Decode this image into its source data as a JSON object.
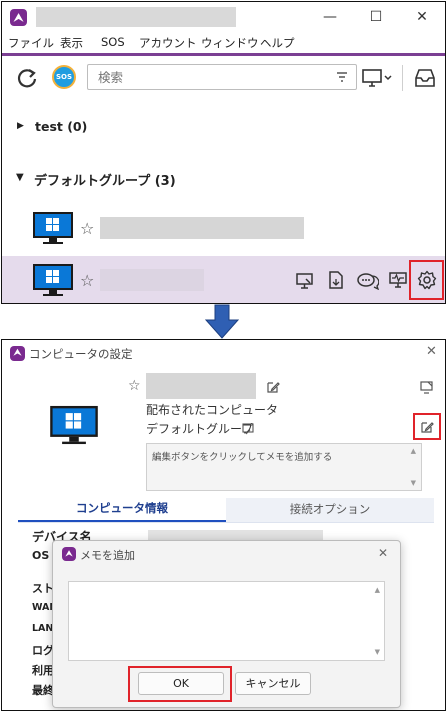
{
  "top_window": {
    "menu": [
      "ファイル",
      "表示",
      "SOS",
      "アカウント",
      "ウィンドウ",
      "ヘルプ"
    ],
    "controls": {
      "minimize": "—",
      "maximize": "☐",
      "close": "✕"
    },
    "search": {
      "placeholder": "検索"
    },
    "sos_badge": "SOS",
    "groups": [
      {
        "label": "test (0)",
        "arrow": "▶"
      },
      {
        "label": "デフォルトグループ (3)",
        "arrow": "▼"
      }
    ]
  },
  "bottom_window": {
    "title": "コンピュータの設定",
    "close": "✕",
    "distributed": "配布されたコンピュータ",
    "group": "デフォルトグループ",
    "memo_placeholder": "編集ボタンをクリックしてメモを追加する",
    "tabs": [
      "コンピュータ情報",
      "接続オプション"
    ],
    "info_labels": [
      "デバイス名",
      "OS バ",
      "ストレ",
      "WAN",
      "LAN",
      "ログ-",
      "利用",
      "最終"
    ],
    "dialog": {
      "title": "メモを追加",
      "close": "✕",
      "ok": "OK",
      "cancel": "キャンセル"
    }
  },
  "colors": {
    "accent_purple": "#7b3f93",
    "highlight_row": "#e5dbec",
    "windows_blue": "#0a78d7",
    "arrow_blue": "#2f5fb3",
    "red_box": "#e0232a"
  }
}
